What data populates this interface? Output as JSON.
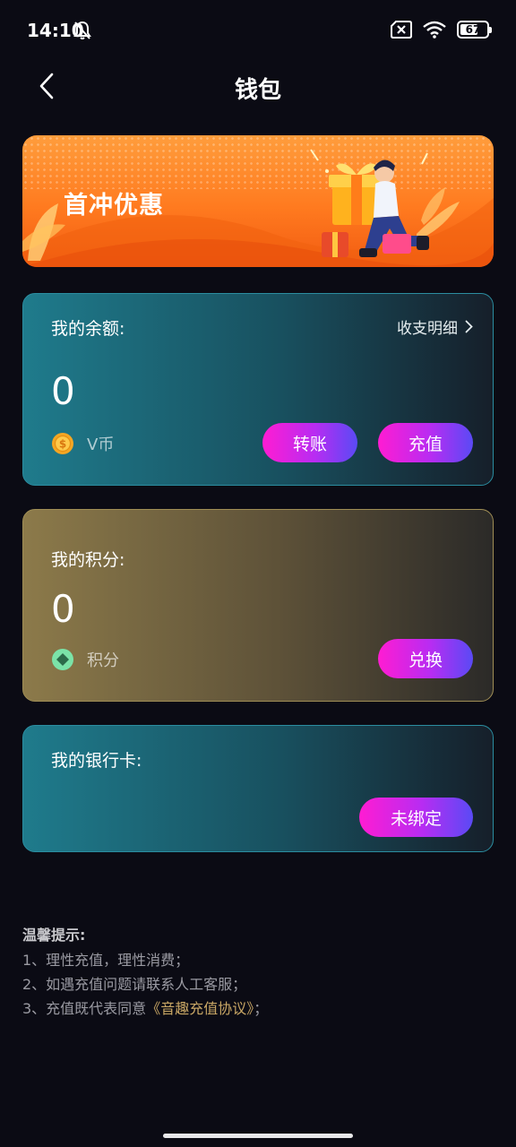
{
  "status_bar": {
    "time": "14:10",
    "battery": "67",
    "battery_level_percent": 67,
    "icons": [
      "bell-off-icon",
      "sim-x-icon",
      "wifi-icon",
      "battery-icon"
    ]
  },
  "nav": {
    "title": "钱包",
    "back_icon": "chevron-left-icon"
  },
  "banner": {
    "title": "首冲优惠"
  },
  "balance_card": {
    "label": "我的余额:",
    "detail_link": "收支明细",
    "amount": "0",
    "unit": "V币",
    "unit_icon": "coin-icon",
    "transfer_button": "转账",
    "recharge_button": "充值"
  },
  "points_card": {
    "label": "我的积分:",
    "amount": "0",
    "unit": "积分",
    "unit_icon": "diamond-icon",
    "exchange_button": "兑换"
  },
  "bank_card": {
    "label": "我的银行卡:",
    "bind_button": "未绑定"
  },
  "tips": {
    "title": "温馨提示:",
    "line1": "1、理性充值，理性消费；",
    "line2": "2、如遇充值问题请联系人工客服；",
    "line3_prefix": "3、充值既代表同意",
    "line3_link": "《音趣充值协议》",
    "line3_suffix": "；"
  },
  "colors": {
    "background": "#0b0b14",
    "button_gradient_start": "#ff1cd2",
    "button_gradient_end": "#5a4af5",
    "banner_orange": "#ff7a1f",
    "link_gold": "#c9a765"
  }
}
